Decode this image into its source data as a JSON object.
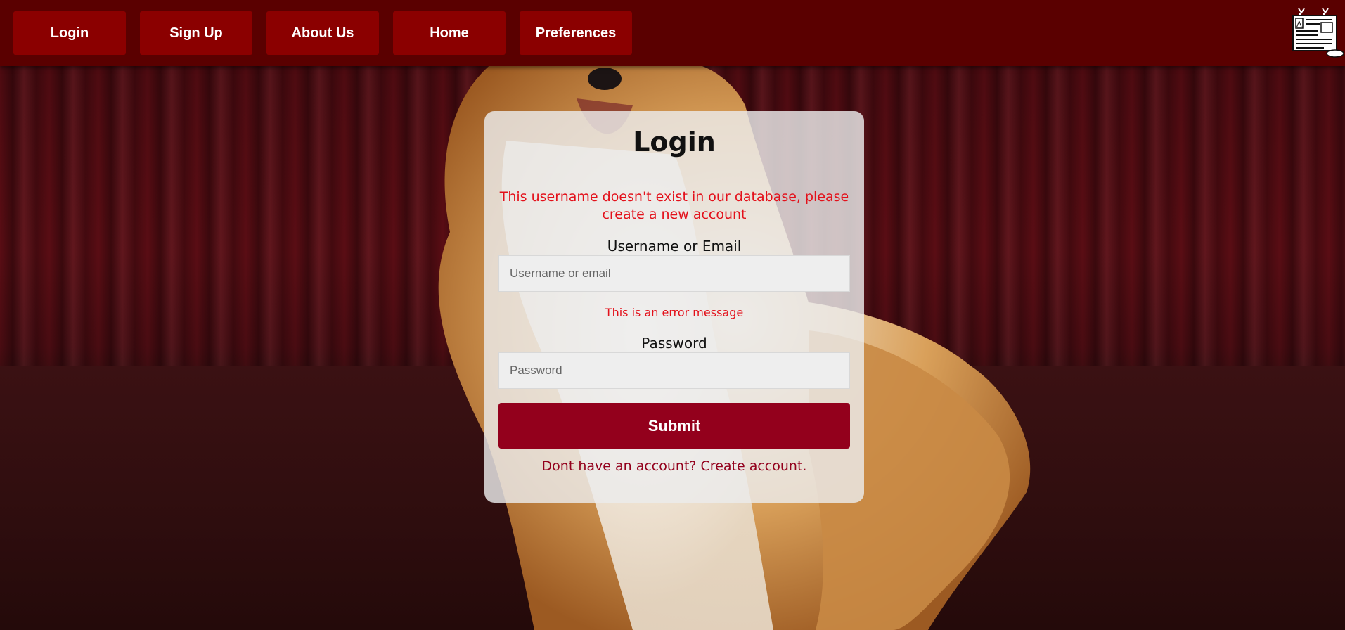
{
  "nav": {
    "buttons": [
      {
        "label": "Login"
      },
      {
        "label": "Sign Up"
      },
      {
        "label": "About Us"
      },
      {
        "label": "Home"
      },
      {
        "label": "Preferences"
      }
    ],
    "logo_icon": "newspaper-logo-icon"
  },
  "login": {
    "title": "Login",
    "error_banner": "This username doesn't exist in our database, please create a new account",
    "username_label": "Username or Email",
    "username_placeholder": "Username or email",
    "username_value": "",
    "username_error": "This is an error message",
    "password_label": "Password",
    "password_placeholder": "Password",
    "password_value": "",
    "submit_label": "Submit",
    "create_account_text": "Dont have an account? Create account."
  },
  "colors": {
    "navbar": "#5a0000",
    "nav_button": "#8b0000",
    "submit": "#93001c",
    "error": "#e3101a"
  }
}
